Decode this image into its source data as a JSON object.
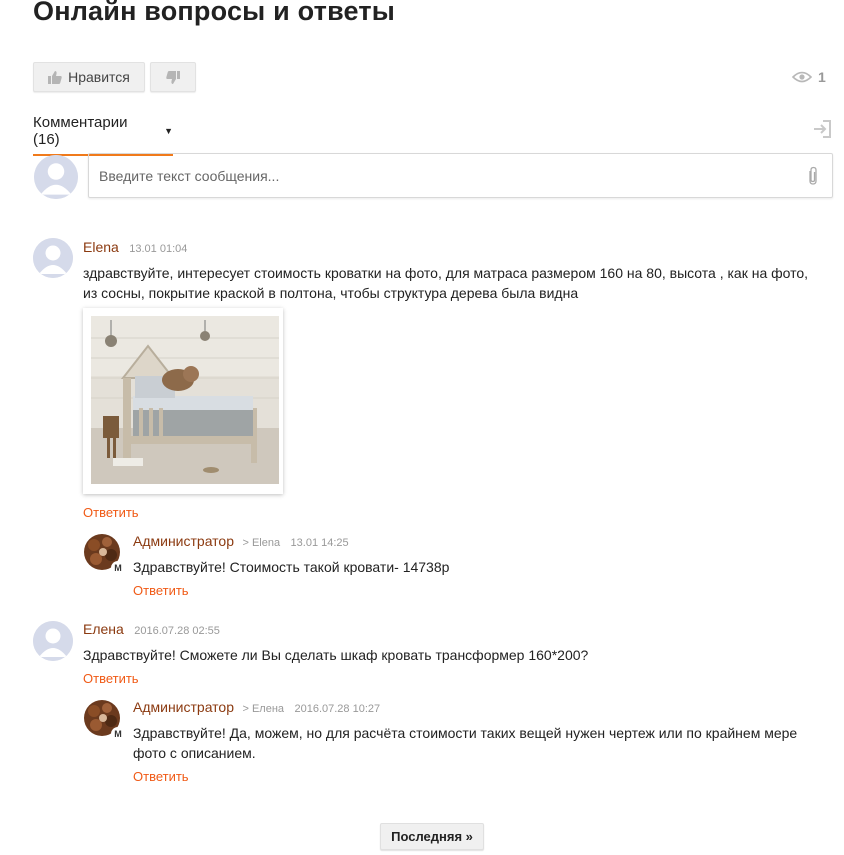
{
  "page": {
    "title": "Онлайн вопросы и ответы"
  },
  "toolbar": {
    "like_label": "Нравится",
    "views_count": "1"
  },
  "comments_tab": {
    "label": "Комментарии (16)"
  },
  "composer": {
    "placeholder": "Введите текст сообщения..."
  },
  "comments": [
    {
      "author": "Elena",
      "date": "13.01 01:04",
      "text": "здравствуйте, интересует стоимость кроватки на фото, для матраса размером 160 на 80, высота , как на фото, из сосны, покрытие краской в полтона, чтобы структура дерева была видна",
      "reply_label": "Ответить",
      "has_photo": true,
      "replies": [
        {
          "author": "Администратор",
          "reply_to": "> Elena",
          "date": "13.01 14:25",
          "text": "Здравствуйте! Стоимость такой кровати- 14738р",
          "reply_label": "Ответить",
          "badge": "M"
        }
      ]
    },
    {
      "author": "Елена",
      "date": "2016.07.28 02:55",
      "text": "Здравствуйте! Сможете ли Вы сделать шкаф кровать трансформер 160*200?",
      "reply_label": "Ответить",
      "replies": [
        {
          "author": "Администратор",
          "reply_to": "> Елена",
          "date": "2016.07.28 10:27",
          "text": "Здравствуйте! Да, можем, но для расчёта стоимости таких вещей нужен чертеж или по крайнем мере фото с описанием.",
          "reply_label": "Ответить",
          "badge": "M"
        }
      ]
    }
  ],
  "pagination": {
    "last_label": "Последняя »"
  },
  "colors": {
    "accent": "#f07a1b",
    "author": "#8b3a10",
    "reply_link": "#f05a16"
  },
  "icons": [
    "thumbs-up-icon",
    "thumbs-down-icon",
    "eye-icon",
    "login-icon",
    "paperclip-icon"
  ]
}
